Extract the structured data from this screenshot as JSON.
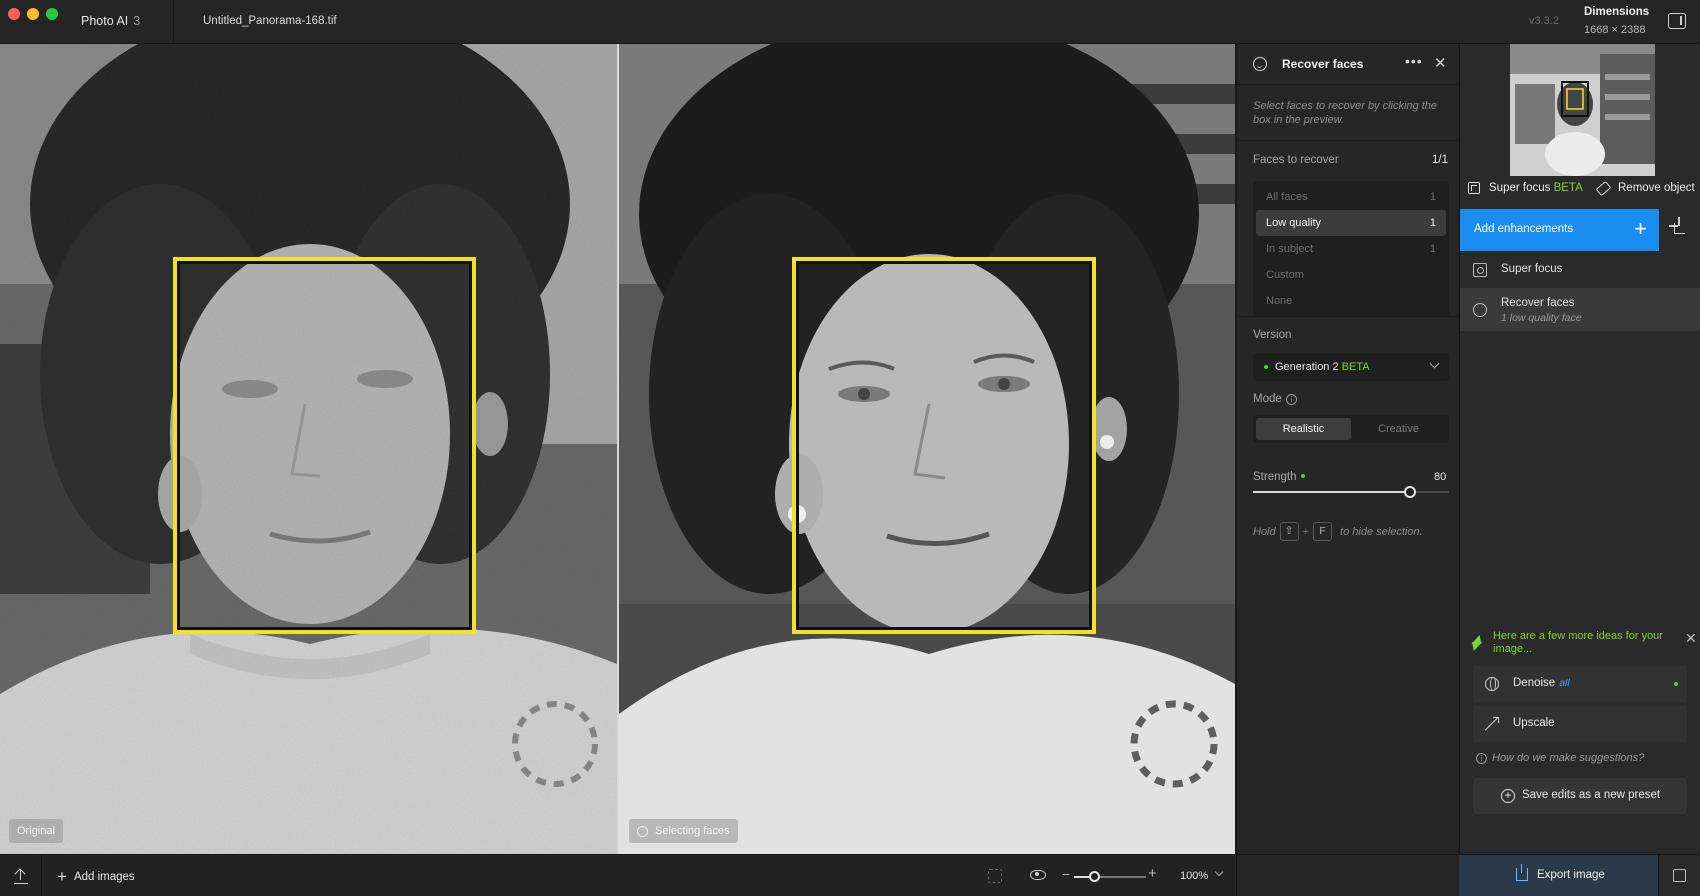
{
  "titlebar": {
    "app_name": "Photo AI",
    "app_version_major": "3",
    "file_name": "Untitled_Panorama-168.tif",
    "build_version": "v3.3.2",
    "dimensions_label": "Dimensions",
    "dimensions_value": "1668 × 2388"
  },
  "preview": {
    "left_tag": "Original",
    "right_tag": "Selecting faces",
    "face_box_color": "#f2e126"
  },
  "settings": {
    "title": "Recover faces",
    "hint": "Select faces to recover by clicking the box in the preview.",
    "faces_label": "Faces to recover",
    "faces_count": "1/1",
    "face_options": [
      {
        "label": "All faces",
        "count": "1"
      },
      {
        "label": "Low quality",
        "count": "1"
      },
      {
        "label": "In subject",
        "count": "1"
      },
      {
        "label": "Custom",
        "count": ""
      },
      {
        "label": "None",
        "count": ""
      }
    ],
    "selected_option": "Low quality",
    "version_label": "Version",
    "version_value": "Generation 2",
    "version_beta": "BETA",
    "mode_label": "Mode",
    "mode_options": [
      "Realistic",
      "Creative"
    ],
    "mode_selected": "Realistic",
    "strength_label": "Strength",
    "strength_value": "80",
    "hold_prefix": "Hold",
    "key_shift": "⇧",
    "key_plus": "+",
    "key_f": "F",
    "hold_suffix": "to hide selection."
  },
  "right_panel": {
    "super_focus": "Super focus",
    "super_focus_beta": "BETA",
    "remove_object": "Remove object",
    "add_enhancements": "Add enhancements",
    "add_plus": "+",
    "enhancements": [
      {
        "name": "Super focus",
        "sub": ""
      },
      {
        "name": "Recover faces",
        "sub": "1 low quality face"
      }
    ],
    "ideas_text": "Here are a few more ideas for your image...",
    "suggestions": [
      {
        "name": "Denoise",
        "tag": "all"
      },
      {
        "name": "Upscale",
        "tag": ""
      }
    ],
    "how_text": "How do we make suggestions?",
    "save_preset": "Save edits as a new preset",
    "export": "Export image",
    "accent_color": "#1a8ef0",
    "highlight_color": "#7ad637"
  },
  "bottom": {
    "add_images": "Add images",
    "zoom_value": "100%",
    "zoom_level": 0.28
  }
}
